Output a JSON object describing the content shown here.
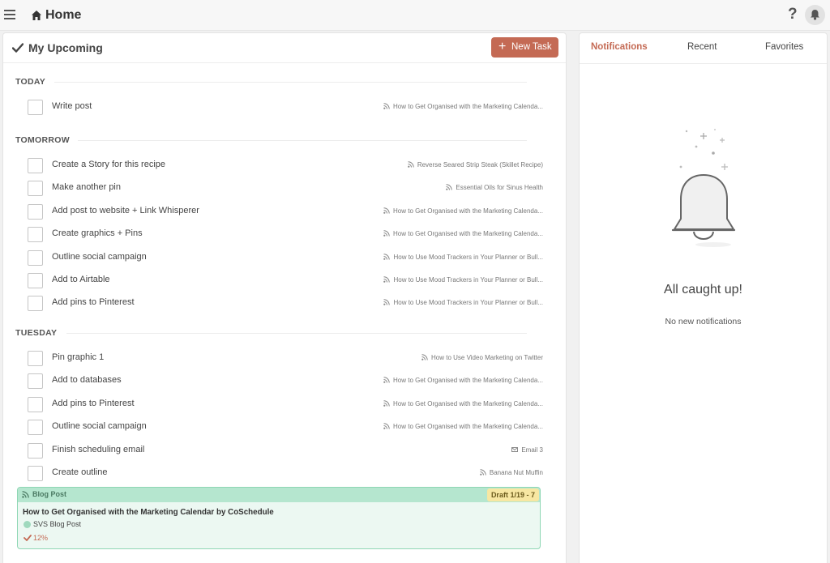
{
  "header": {
    "title": "Home",
    "help_label": "?"
  },
  "upcoming": {
    "title": "My Upcoming",
    "new_task_plus": "+",
    "new_task_label": "New Task",
    "sections": [
      {
        "label": "TODAY",
        "tasks": [
          {
            "title": "Write post",
            "link": "How to Get Organised with the Marketing Calenda..."
          }
        ]
      },
      {
        "label": "TOMORROW",
        "tasks": [
          {
            "title": "Create a Story for this recipe",
            "link": "Reverse Seared Strip Steak (Skillet Recipe)"
          },
          {
            "title": "Make another pin",
            "link": "Essential Oils for Sinus Health"
          },
          {
            "title": "Add post to website + Link Whisperer",
            "link": "How to Get Organised with the Marketing Calenda..."
          },
          {
            "title": "Create graphics + Pins",
            "link": "How to Get Organised with the Marketing Calenda..."
          },
          {
            "title": "Outline social campaign",
            "link": "How to Use Mood Trackers in Your Planner or Bull..."
          },
          {
            "title": "Add to Airtable",
            "link": "How to Use Mood Trackers in Your Planner or Bull..."
          },
          {
            "title": "Add pins to Pinterest",
            "link": "How to Use Mood Trackers in Your Planner or Bull..."
          }
        ]
      },
      {
        "label": "TUESDAY",
        "tasks": [
          {
            "title": "Pin graphic 1",
            "link": "How to Use Video Marketing on Twitter"
          },
          {
            "title": "Add to databases",
            "link": "How to Get Organised with the Marketing Calenda..."
          },
          {
            "title": "Add pins to Pinterest",
            "link": "How to Get Organised with the Marketing Calenda..."
          },
          {
            "title": "Outline social campaign",
            "link": "How to Get Organised with the Marketing Calenda..."
          },
          {
            "title": "Finish scheduling email",
            "link": "Email 3",
            "icon": "email-icon"
          },
          {
            "title": "Create outline",
            "link": "Banana Nut Muffin"
          }
        ]
      }
    ],
    "blog_card": {
      "type": "Blog Post",
      "status": "Draft",
      "date": "1/19 - 7",
      "title": "How to Get Organised with the Marketing Calendar by CoSchedule",
      "project": "SVS Blog Post",
      "progress": "12%"
    }
  },
  "notifications": {
    "tabs": [
      "Notifications",
      "Recent",
      "Favorites"
    ],
    "active_tab": "Notifications",
    "empty_title": "All caught up!",
    "empty_subtitle": "No new notifications"
  },
  "colors": {
    "accent": "#c46a54",
    "blog_green": "#b5e6cf",
    "draft_yellow": "#f7e7a2"
  },
  "icons": [
    "menu-icon",
    "home-icon",
    "help-icon",
    "bell-icon",
    "check-icon",
    "plus-icon",
    "feed-icon",
    "email-icon"
  ]
}
